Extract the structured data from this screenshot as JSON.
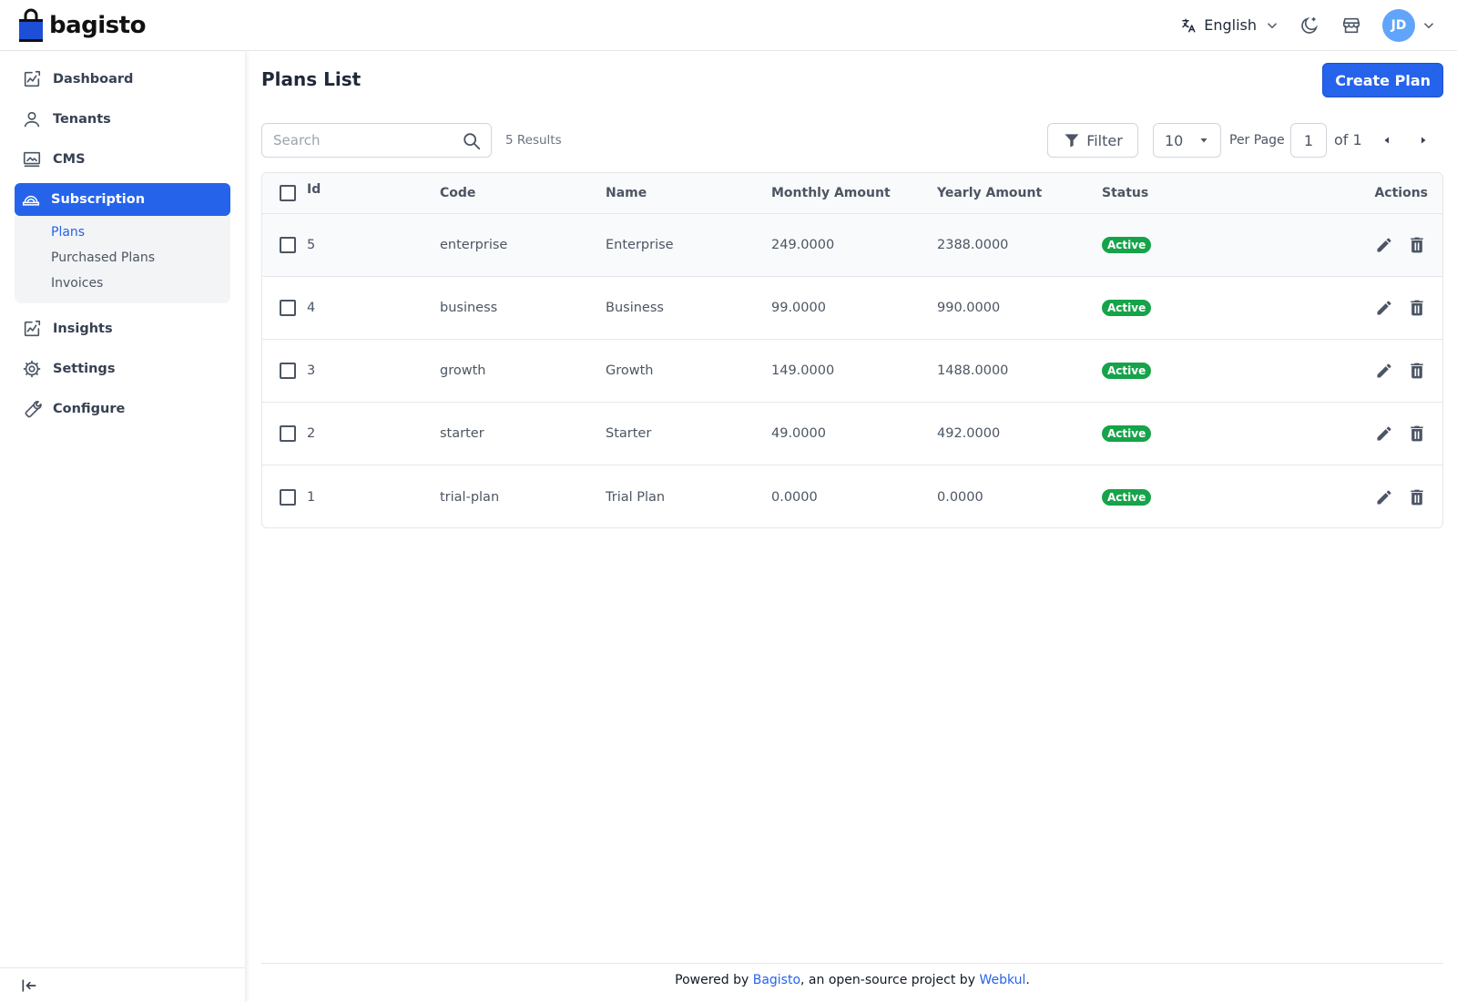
{
  "brand": {
    "name": "bagisto",
    "logo_color": "#1d4ed8"
  },
  "header": {
    "language": "English",
    "user_initials": "JD"
  },
  "sidebar": {
    "items": [
      {
        "label": "Dashboard",
        "icon": "dashboard-icon"
      },
      {
        "label": "Tenants",
        "icon": "user-icon"
      },
      {
        "label": "CMS",
        "icon": "cms-icon"
      },
      {
        "label": "Subscription",
        "icon": "subscription-icon",
        "active": true,
        "children": [
          "Plans",
          "Purchased Plans",
          "Invoices"
        ],
        "current_child": "Plans"
      },
      {
        "label": "Insights",
        "icon": "insights-icon"
      },
      {
        "label": "Settings",
        "icon": "gear-icon"
      },
      {
        "label": "Configure",
        "icon": "wrench-icon"
      }
    ]
  },
  "page": {
    "title": "Plans List",
    "create_label": "Create Plan"
  },
  "toolbar": {
    "search_placeholder": "Search",
    "results": "5 Results",
    "filter_label": "Filter",
    "per_page_value": "10",
    "per_page_label": "Per Page",
    "page_value": "1",
    "of_label": "of 1"
  },
  "table": {
    "headers": [
      "Id",
      "Code",
      "Name",
      "Monthly Amount",
      "Yearly Amount",
      "Status",
      "Actions"
    ],
    "rows": [
      {
        "id": "5",
        "code": "enterprise",
        "name": "Enterprise",
        "monthly": "249.0000",
        "yearly": "2388.0000",
        "status": "Active"
      },
      {
        "id": "4",
        "code": "business",
        "name": "Business",
        "monthly": "99.0000",
        "yearly": "990.0000",
        "status": "Active"
      },
      {
        "id": "3",
        "code": "growth",
        "name": "Growth",
        "monthly": "149.0000",
        "yearly": "1488.0000",
        "status": "Active"
      },
      {
        "id": "2",
        "code": "starter",
        "name": "Starter",
        "monthly": "49.0000",
        "yearly": "492.0000",
        "status": "Active"
      },
      {
        "id": "1",
        "code": "trial-plan",
        "name": "Trial Plan",
        "monthly": "0.0000",
        "yearly": "0.0000",
        "status": "Active"
      }
    ]
  },
  "footer": {
    "prefix": "Powered by ",
    "link1": "Bagisto",
    "middle": ", an open-source project by ",
    "link2": "Webkul",
    "suffix": "."
  },
  "colors": {
    "primary": "#2563eb",
    "success": "#16a34a",
    "avatar": "#60a5fa"
  }
}
